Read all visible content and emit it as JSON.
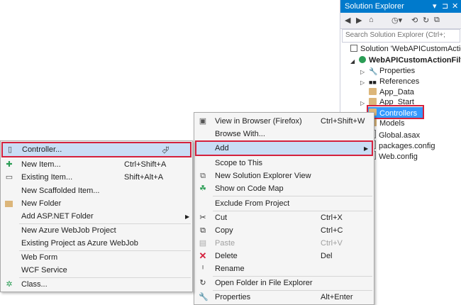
{
  "solution_explorer": {
    "title": "Solution Explorer",
    "title_buttons": [
      "▾",
      "⊐",
      "✕"
    ],
    "toolbar_icons": [
      "back-icon",
      "forward-icon",
      "home-icon",
      "history-icon",
      "refresh-icon",
      "collapse-icon"
    ],
    "search_placeholder": "Search Solution Explorer (Ctrl+;",
    "tree": [
      {
        "label": "Solution 'WebAPICustomAction"
      },
      {
        "label": "WebAPICustomActionFilter"
      },
      {
        "label": "Properties"
      },
      {
        "label": "References"
      },
      {
        "label": "App_Data"
      },
      {
        "label": "App_Start"
      },
      {
        "label": "Controllers"
      },
      {
        "label": "Models"
      },
      {
        "label": "Global.asax"
      },
      {
        "label": "packages.config"
      },
      {
        "label": "Web.config"
      }
    ]
  },
  "context_menu": {
    "items": [
      {
        "label": "View in Browser (Firefox)",
        "shortcut": "Ctrl+Shift+W"
      },
      {
        "label": "Browse With..."
      },
      {
        "label": "Add"
      },
      {
        "label": "Scope to This"
      },
      {
        "label": "New Solution Explorer View"
      },
      {
        "label": "Show on Code Map"
      },
      {
        "label": "Exclude From Project"
      },
      {
        "label": "Cut",
        "shortcut": "Ctrl+X"
      },
      {
        "label": "Copy",
        "shortcut": "Ctrl+C"
      },
      {
        "label": "Paste",
        "shortcut": "Ctrl+V"
      },
      {
        "label": "Delete",
        "shortcut": "Del"
      },
      {
        "label": "Rename"
      },
      {
        "label": "Open Folder in File Explorer"
      },
      {
        "label": "Properties",
        "shortcut": "Alt+Enter"
      }
    ]
  },
  "add_submenu": {
    "items": [
      {
        "label": "Controller..."
      },
      {
        "label": "New Item...",
        "shortcut": "Ctrl+Shift+A"
      },
      {
        "label": "Existing Item...",
        "shortcut": "Shift+Alt+A"
      },
      {
        "label": "New Scaffolded Item..."
      },
      {
        "label": "New Folder"
      },
      {
        "label": "Add ASP.NET Folder"
      },
      {
        "label": "New Azure WebJob Project"
      },
      {
        "label": "Existing Project as Azure WebJob"
      },
      {
        "label": "Web Form"
      },
      {
        "label": "WCF Service"
      },
      {
        "label": "Class..."
      }
    ]
  },
  "colors": {
    "accent": "#007acc",
    "highlight": "#c9ddf5",
    "callout": "#d4213d",
    "selected_tree": "#3399ff"
  }
}
